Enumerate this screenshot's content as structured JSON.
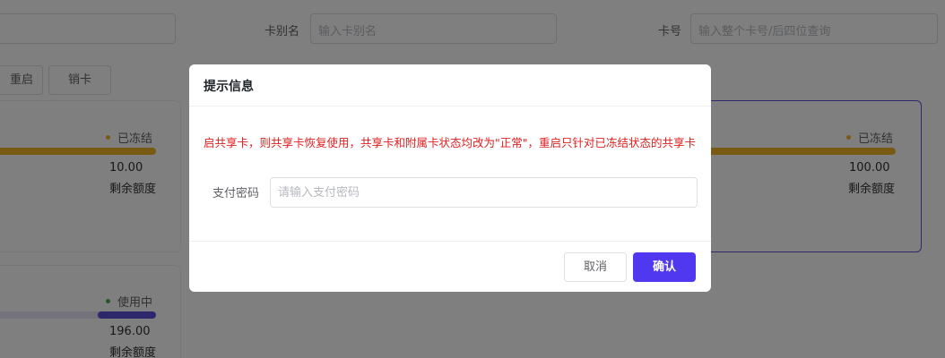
{
  "filters": {
    "card_alias_label": "卡别名",
    "card_alias_placeholder": "输入卡别名",
    "card_number_label": "卡号",
    "card_number_placeholder": "输入整个卡号/后四位查询"
  },
  "toolbar": {
    "restart_label": "重启",
    "cancel_card_label": "销卡"
  },
  "cards": [
    {
      "status": "已冻结",
      "status_color": "#f0b429",
      "usage_fraction": 1.0,
      "bar_color": "#f0b429",
      "amount": "10.00",
      "amount_label": "剩余额度"
    },
    {
      "status": "已冻结",
      "status_color": "#f0b429",
      "usage_fraction": 1.0,
      "bar_color": "#f0b429",
      "amount": "100.00",
      "amount_label": "剩余额度"
    },
    {
      "status": "使用中",
      "status_color": "#4caf50",
      "bar_color": "#5a4fd8",
      "amount": "196.00",
      "amount_label": "剩余额度"
    }
  ],
  "dialog": {
    "title": "提示信息",
    "notice": "启共享卡，则共享卡恢复使用，共享卡和附属卡状态均改为\"正常\"，重启只针对已冻结状态的共享卡",
    "password_label": "支付密码",
    "password_placeholder": "请输入支付密码",
    "cancel_label": "取消",
    "confirm_label": "确认"
  },
  "colors": {
    "primary": "#4f38f0",
    "notice_text": "#e02020",
    "frozen": "#f0b429",
    "active": "#4caf50"
  }
}
